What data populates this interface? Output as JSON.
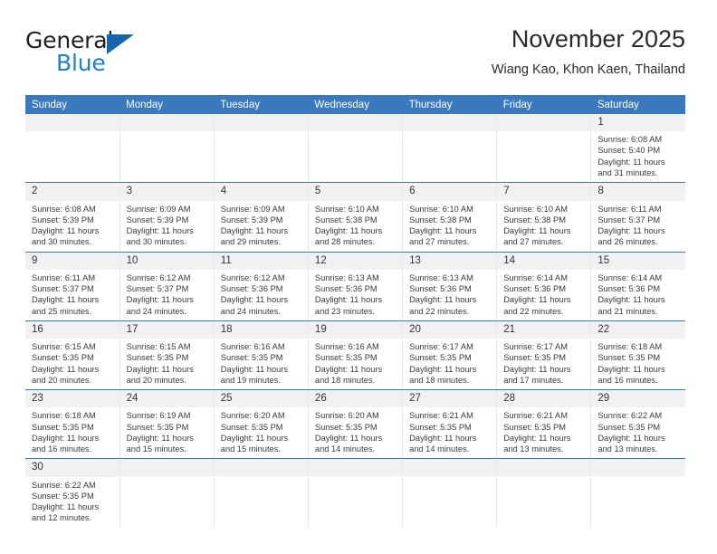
{
  "brand": {
    "name_top": "General",
    "name_bottom": "Blue",
    "accent_color": "#1f7fd0",
    "triangle_color": "#1565b0"
  },
  "header": {
    "title": "November 2025",
    "subtitle": "Wiang Kao, Khon Kaen, Thailand"
  },
  "theme": {
    "header_blue": "#3b79bf",
    "daynum_bg": "#f1f1f1",
    "cell_border": "#e8e8e8",
    "week_border": "#3b79bf"
  },
  "weekdays": [
    "Sunday",
    "Monday",
    "Tuesday",
    "Wednesday",
    "Thursday",
    "Friday",
    "Saturday"
  ],
  "weeks": [
    [
      {
        "day": "",
        "sunrise": "",
        "sunset": "",
        "daylight1": "",
        "daylight2": ""
      },
      {
        "day": "",
        "sunrise": "",
        "sunset": "",
        "daylight1": "",
        "daylight2": ""
      },
      {
        "day": "",
        "sunrise": "",
        "sunset": "",
        "daylight1": "",
        "daylight2": ""
      },
      {
        "day": "",
        "sunrise": "",
        "sunset": "",
        "daylight1": "",
        "daylight2": ""
      },
      {
        "day": "",
        "sunrise": "",
        "sunset": "",
        "daylight1": "",
        "daylight2": ""
      },
      {
        "day": "",
        "sunrise": "",
        "sunset": "",
        "daylight1": "",
        "daylight2": ""
      },
      {
        "day": "1",
        "sunrise": "Sunrise: 6:08 AM",
        "sunset": "Sunset: 5:40 PM",
        "daylight1": "Daylight: 11 hours",
        "daylight2": "and 31 minutes."
      }
    ],
    [
      {
        "day": "2",
        "sunrise": "Sunrise: 6:08 AM",
        "sunset": "Sunset: 5:39 PM",
        "daylight1": "Daylight: 11 hours",
        "daylight2": "and 30 minutes."
      },
      {
        "day": "3",
        "sunrise": "Sunrise: 6:09 AM",
        "sunset": "Sunset: 5:39 PM",
        "daylight1": "Daylight: 11 hours",
        "daylight2": "and 30 minutes."
      },
      {
        "day": "4",
        "sunrise": "Sunrise: 6:09 AM",
        "sunset": "Sunset: 5:39 PM",
        "daylight1": "Daylight: 11 hours",
        "daylight2": "and 29 minutes."
      },
      {
        "day": "5",
        "sunrise": "Sunrise: 6:10 AM",
        "sunset": "Sunset: 5:38 PM",
        "daylight1": "Daylight: 11 hours",
        "daylight2": "and 28 minutes."
      },
      {
        "day": "6",
        "sunrise": "Sunrise: 6:10 AM",
        "sunset": "Sunset: 5:38 PM",
        "daylight1": "Daylight: 11 hours",
        "daylight2": "and 27 minutes."
      },
      {
        "day": "7",
        "sunrise": "Sunrise: 6:10 AM",
        "sunset": "Sunset: 5:38 PM",
        "daylight1": "Daylight: 11 hours",
        "daylight2": "and 27 minutes."
      },
      {
        "day": "8",
        "sunrise": "Sunrise: 6:11 AM",
        "sunset": "Sunset: 5:37 PM",
        "daylight1": "Daylight: 11 hours",
        "daylight2": "and 26 minutes."
      }
    ],
    [
      {
        "day": "9",
        "sunrise": "Sunrise: 6:11 AM",
        "sunset": "Sunset: 5:37 PM",
        "daylight1": "Daylight: 11 hours",
        "daylight2": "and 25 minutes."
      },
      {
        "day": "10",
        "sunrise": "Sunrise: 6:12 AM",
        "sunset": "Sunset: 5:37 PM",
        "daylight1": "Daylight: 11 hours",
        "daylight2": "and 24 minutes."
      },
      {
        "day": "11",
        "sunrise": "Sunrise: 6:12 AM",
        "sunset": "Sunset: 5:36 PM",
        "daylight1": "Daylight: 11 hours",
        "daylight2": "and 24 minutes."
      },
      {
        "day": "12",
        "sunrise": "Sunrise: 6:13 AM",
        "sunset": "Sunset: 5:36 PM",
        "daylight1": "Daylight: 11 hours",
        "daylight2": "and 23 minutes."
      },
      {
        "day": "13",
        "sunrise": "Sunrise: 6:13 AM",
        "sunset": "Sunset: 5:36 PM",
        "daylight1": "Daylight: 11 hours",
        "daylight2": "and 22 minutes."
      },
      {
        "day": "14",
        "sunrise": "Sunrise: 6:14 AM",
        "sunset": "Sunset: 5:36 PM",
        "daylight1": "Daylight: 11 hours",
        "daylight2": "and 22 minutes."
      },
      {
        "day": "15",
        "sunrise": "Sunrise: 6:14 AM",
        "sunset": "Sunset: 5:36 PM",
        "daylight1": "Daylight: 11 hours",
        "daylight2": "and 21 minutes."
      }
    ],
    [
      {
        "day": "16",
        "sunrise": "Sunrise: 6:15 AM",
        "sunset": "Sunset: 5:35 PM",
        "daylight1": "Daylight: 11 hours",
        "daylight2": "and 20 minutes."
      },
      {
        "day": "17",
        "sunrise": "Sunrise: 6:15 AM",
        "sunset": "Sunset: 5:35 PM",
        "daylight1": "Daylight: 11 hours",
        "daylight2": "and 20 minutes."
      },
      {
        "day": "18",
        "sunrise": "Sunrise: 6:16 AM",
        "sunset": "Sunset: 5:35 PM",
        "daylight1": "Daylight: 11 hours",
        "daylight2": "and 19 minutes."
      },
      {
        "day": "19",
        "sunrise": "Sunrise: 6:16 AM",
        "sunset": "Sunset: 5:35 PM",
        "daylight1": "Daylight: 11 hours",
        "daylight2": "and 18 minutes."
      },
      {
        "day": "20",
        "sunrise": "Sunrise: 6:17 AM",
        "sunset": "Sunset: 5:35 PM",
        "daylight1": "Daylight: 11 hours",
        "daylight2": "and 18 minutes."
      },
      {
        "day": "21",
        "sunrise": "Sunrise: 6:17 AM",
        "sunset": "Sunset: 5:35 PM",
        "daylight1": "Daylight: 11 hours",
        "daylight2": "and 17 minutes."
      },
      {
        "day": "22",
        "sunrise": "Sunrise: 6:18 AM",
        "sunset": "Sunset: 5:35 PM",
        "daylight1": "Daylight: 11 hours",
        "daylight2": "and 16 minutes."
      }
    ],
    [
      {
        "day": "23",
        "sunrise": "Sunrise: 6:18 AM",
        "sunset": "Sunset: 5:35 PM",
        "daylight1": "Daylight: 11 hours",
        "daylight2": "and 16 minutes."
      },
      {
        "day": "24",
        "sunrise": "Sunrise: 6:19 AM",
        "sunset": "Sunset: 5:35 PM",
        "daylight1": "Daylight: 11 hours",
        "daylight2": "and 15 minutes."
      },
      {
        "day": "25",
        "sunrise": "Sunrise: 6:20 AM",
        "sunset": "Sunset: 5:35 PM",
        "daylight1": "Daylight: 11 hours",
        "daylight2": "and 15 minutes."
      },
      {
        "day": "26",
        "sunrise": "Sunrise: 6:20 AM",
        "sunset": "Sunset: 5:35 PM",
        "daylight1": "Daylight: 11 hours",
        "daylight2": "and 14 minutes."
      },
      {
        "day": "27",
        "sunrise": "Sunrise: 6:21 AM",
        "sunset": "Sunset: 5:35 PM",
        "daylight1": "Daylight: 11 hours",
        "daylight2": "and 14 minutes."
      },
      {
        "day": "28",
        "sunrise": "Sunrise: 6:21 AM",
        "sunset": "Sunset: 5:35 PM",
        "daylight1": "Daylight: 11 hours",
        "daylight2": "and 13 minutes."
      },
      {
        "day": "29",
        "sunrise": "Sunrise: 6:22 AM",
        "sunset": "Sunset: 5:35 PM",
        "daylight1": "Daylight: 11 hours",
        "daylight2": "and 13 minutes."
      }
    ],
    [
      {
        "day": "30",
        "sunrise": "Sunrise: 6:22 AM",
        "sunset": "Sunset: 5:35 PM",
        "daylight1": "Daylight: 11 hours",
        "daylight2": "and 12 minutes."
      },
      {
        "day": "",
        "sunrise": "",
        "sunset": "",
        "daylight1": "",
        "daylight2": ""
      },
      {
        "day": "",
        "sunrise": "",
        "sunset": "",
        "daylight1": "",
        "daylight2": ""
      },
      {
        "day": "",
        "sunrise": "",
        "sunset": "",
        "daylight1": "",
        "daylight2": ""
      },
      {
        "day": "",
        "sunrise": "",
        "sunset": "",
        "daylight1": "",
        "daylight2": ""
      },
      {
        "day": "",
        "sunrise": "",
        "sunset": "",
        "daylight1": "",
        "daylight2": ""
      },
      {
        "day": "",
        "sunrise": "",
        "sunset": "",
        "daylight1": "",
        "daylight2": ""
      }
    ]
  ]
}
